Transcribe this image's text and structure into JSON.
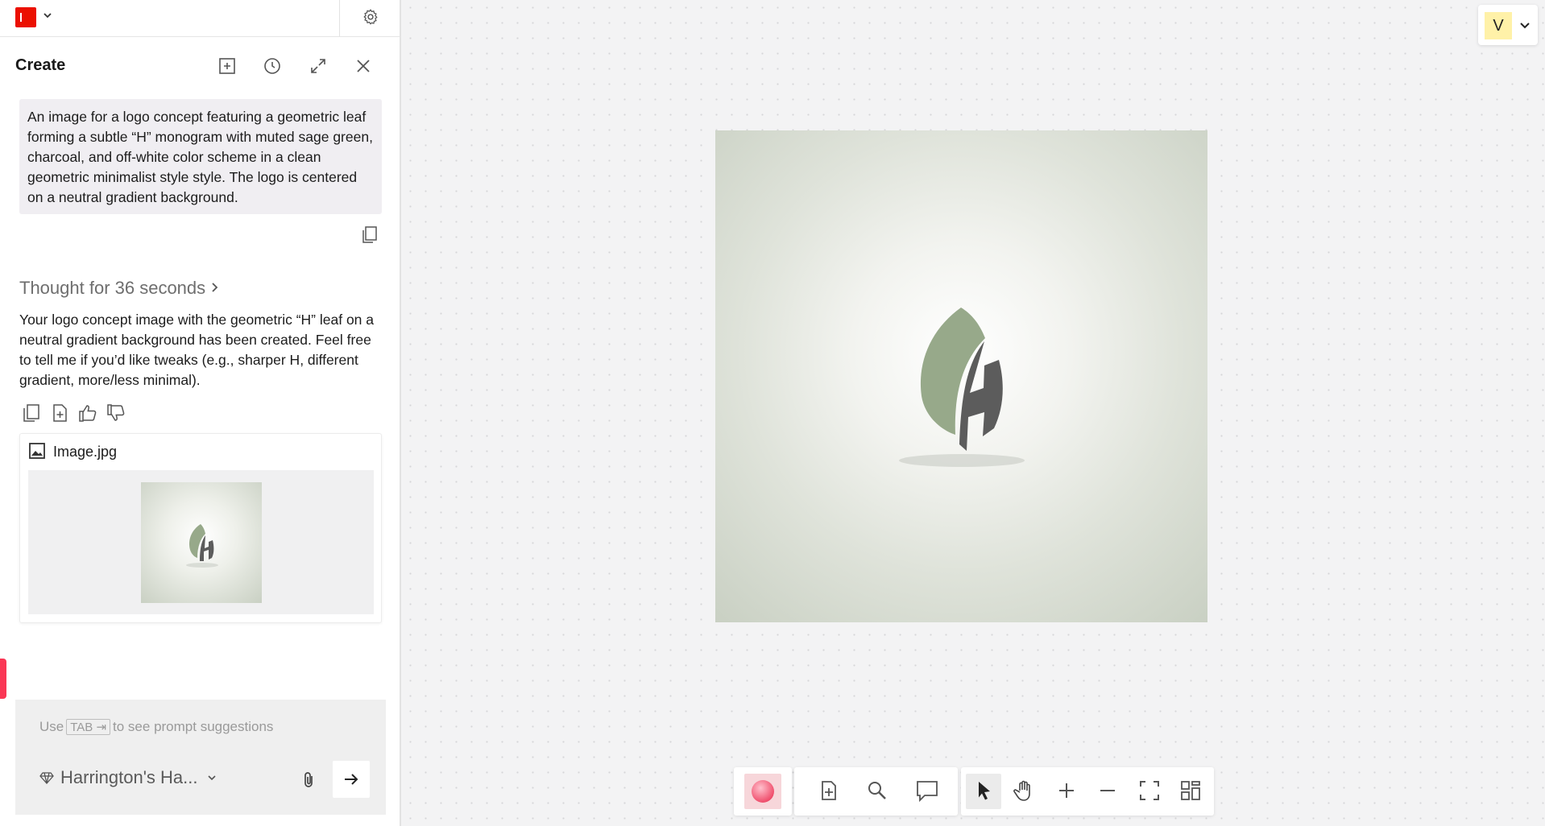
{
  "panel": {
    "title": "Create",
    "prompt_text": "An image for a logo concept featuring a geometric leaf forming a subtle “H” monogram with muted sage green, charcoal, and off-white color scheme in a clean geometric minimalist style style. The logo is centered on a neutral gradient background.",
    "thought_label": "Thought for 36 seconds",
    "answer_text": "Your logo concept image with the geometric “H” leaf on a neutral gradient background has been created. Feel free to tell me if you’d like tweaks (e.g., sharper H, different gradient, more/less minimal).",
    "attachment": {
      "name": "Image.jpg",
      "icon": "image-icon"
    },
    "composer": {
      "placeholder_before": "Use",
      "tab_key": "TAB ⇥",
      "placeholder_after": "to see prompt suggestions",
      "model_label": "Harrington's Ha..."
    },
    "header_icons": [
      "new-chat-icon",
      "history-icon",
      "expand-icon",
      "close-icon"
    ],
    "answer_actions": [
      "copy-icon",
      "add-to-canvas-icon",
      "thumbs-up-icon",
      "thumbs-down-icon"
    ]
  },
  "user": {
    "initial": "V"
  },
  "colors": {
    "brand": "#eb1000",
    "sage": "#97a98a",
    "charcoal": "#5c5c5c",
    "avatar_bg": "#fff1a8",
    "accent_tab": "#fa3755"
  },
  "canvas_toolbar": [
    "color-swatch-icon",
    "add-page-icon",
    "search-icon",
    "comment-icon",
    "select-arrow-icon",
    "hand-icon",
    "zoom-in-icon",
    "zoom-out-icon",
    "fit-screen-icon",
    "grid-view-icon"
  ]
}
